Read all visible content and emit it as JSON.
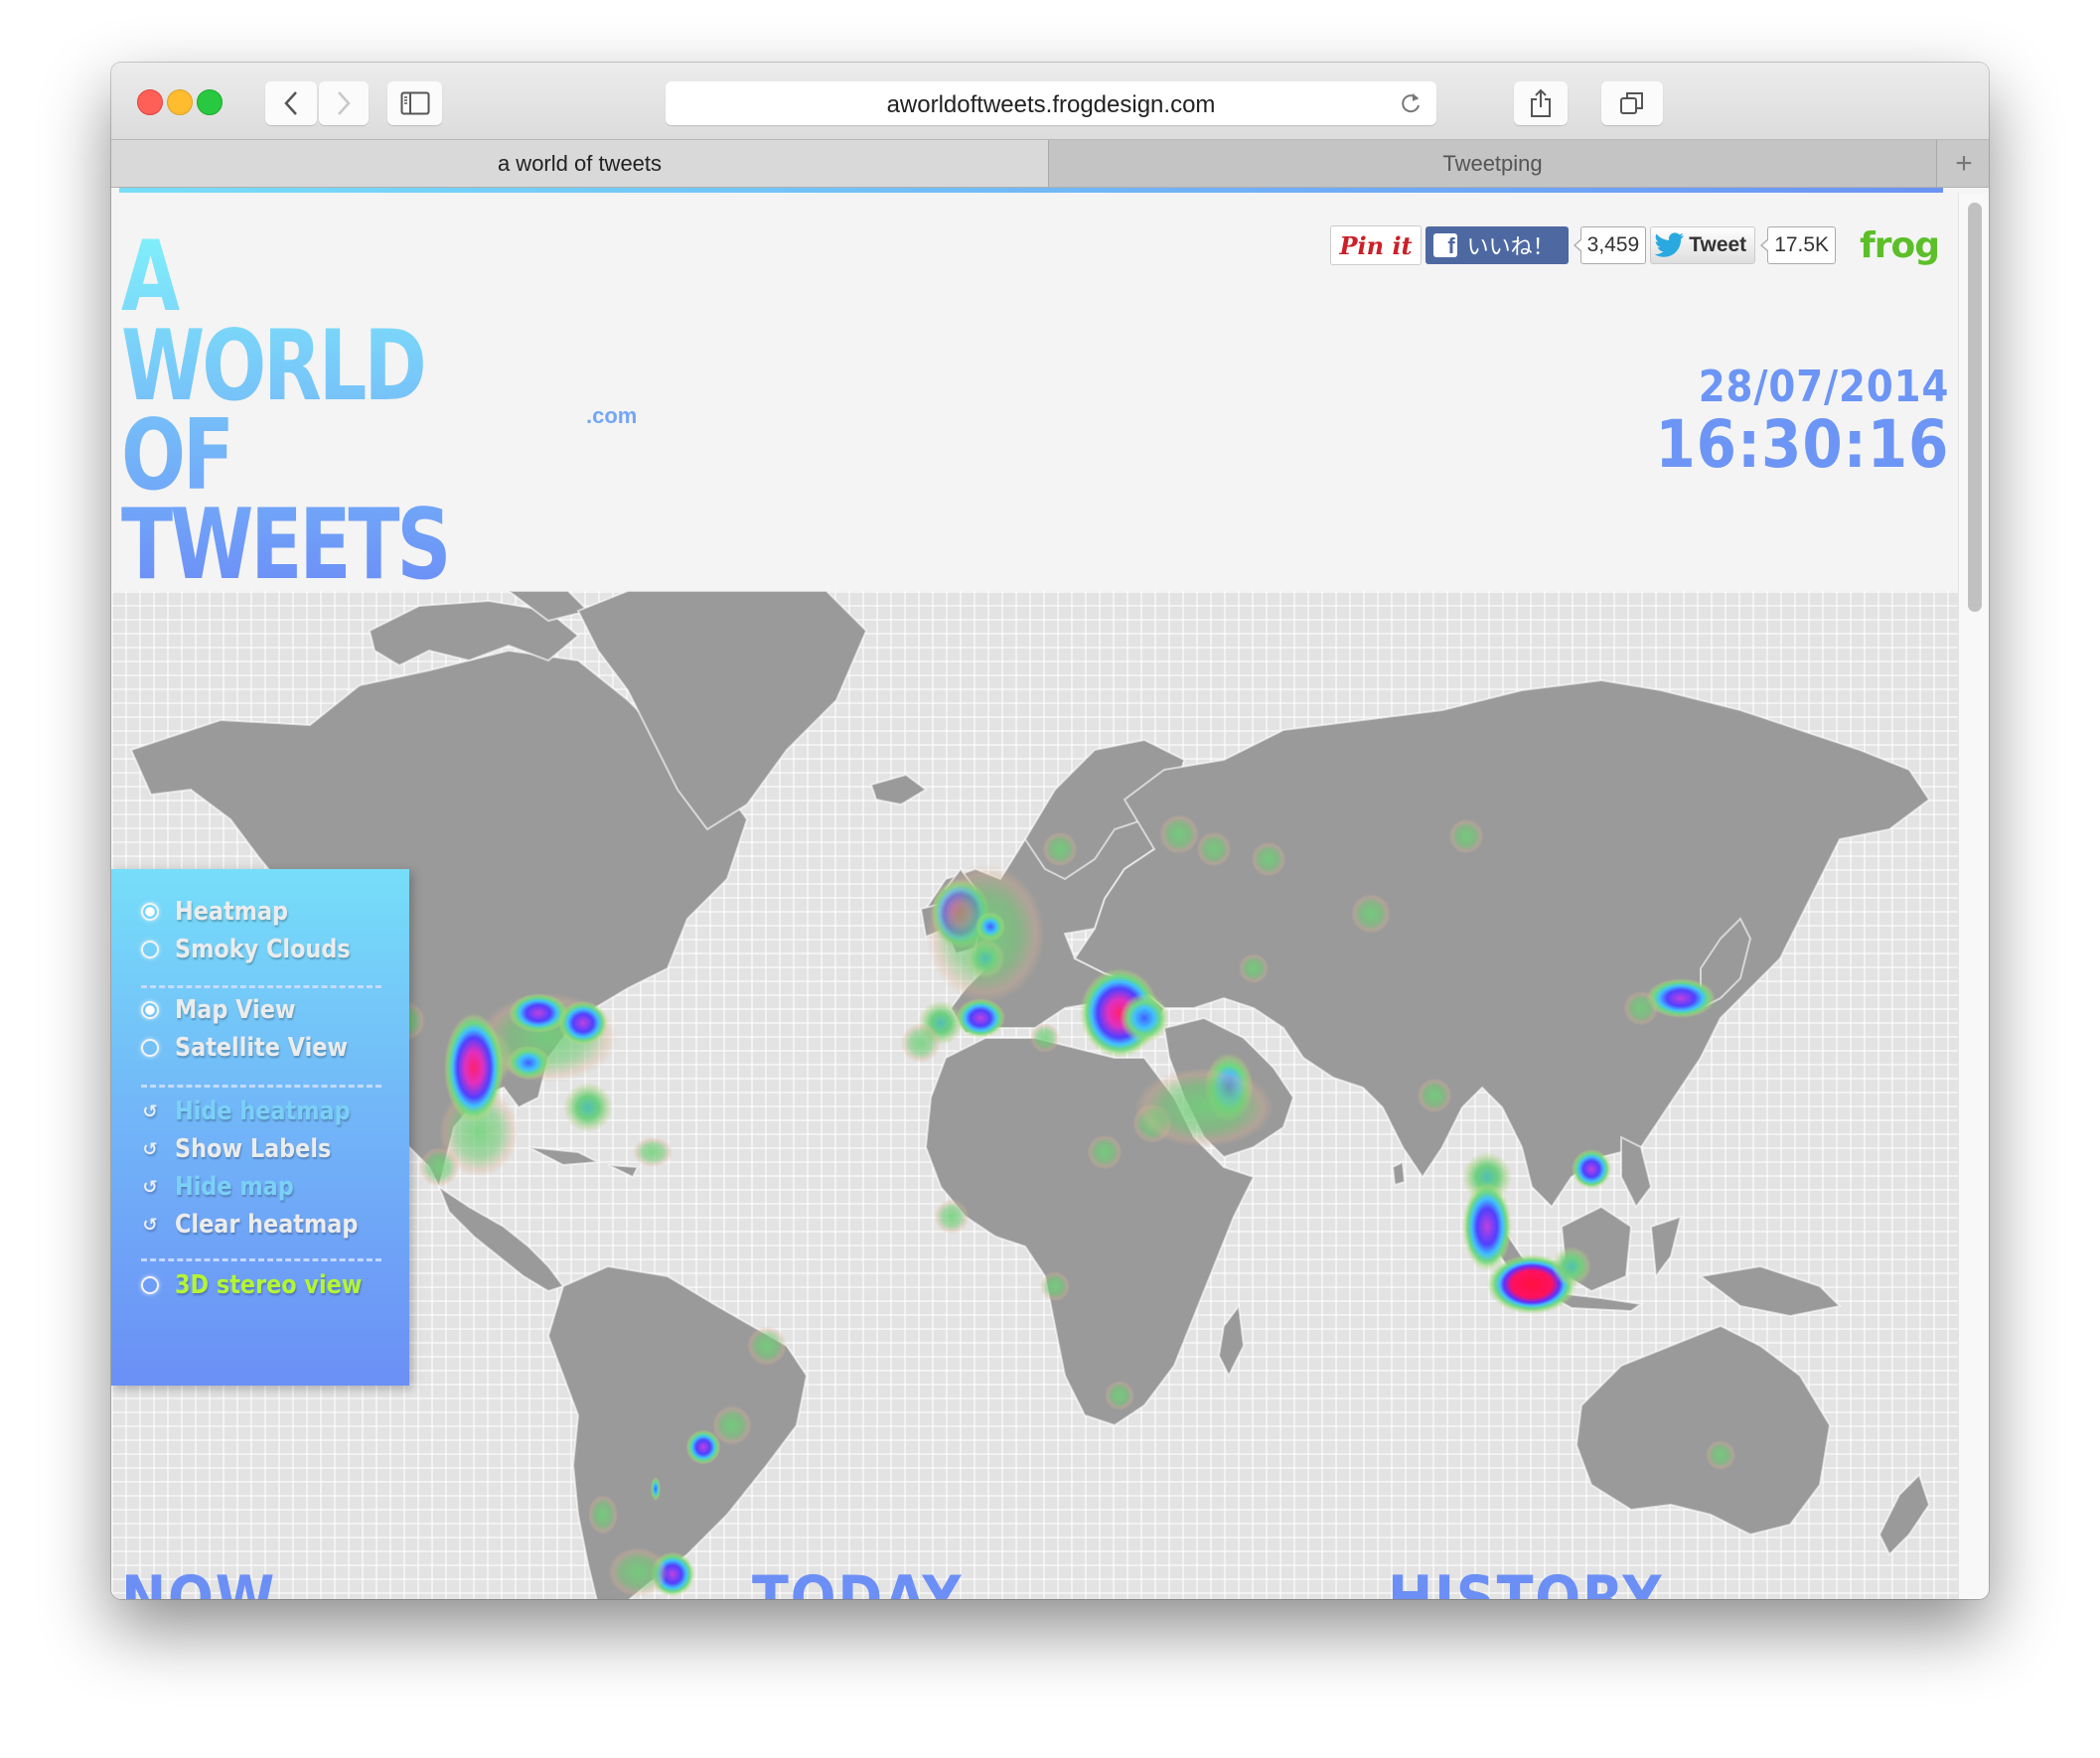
{
  "browser": {
    "url": "aworldoftweets.frogdesign.com",
    "tabs": [
      {
        "label": "a world of tweets",
        "active": true
      },
      {
        "label": "Tweetping",
        "active": false
      }
    ],
    "icons": {
      "back": "chevron-left-icon",
      "forward": "chevron-right-icon",
      "sidebar": "sidebar-icon",
      "reload": "reload-icon",
      "share": "share-icon",
      "tabs": "tab-overview-icon",
      "new_tab": "plus-icon"
    }
  },
  "page": {
    "logo": {
      "line1": "A",
      "line2": "WORLD",
      "line3": "OF TWEETS",
      "suffix": ".com"
    },
    "date": "28/07/2014",
    "time": "16:30:16",
    "social": {
      "pinit": "Pin it",
      "fb_like": "いいね！",
      "fb_count": "3,459",
      "tweet": "Tweet",
      "tweet_count": "17.5K",
      "brand": "frog"
    },
    "controls": {
      "render_modes": [
        {
          "label": "Heatmap",
          "selected": true
        },
        {
          "label": "Smoky Clouds",
          "selected": false
        }
      ],
      "view_modes": [
        {
          "label": "Map View",
          "selected": true
        },
        {
          "label": "Satellite View",
          "selected": false
        }
      ],
      "actions": [
        {
          "label": "Hide heatmap",
          "enabled": false
        },
        {
          "label": "Show Labels",
          "enabled": true
        },
        {
          "label": "Hide map",
          "enabled": false
        },
        {
          "label": "Clear heatmap",
          "enabled": true
        }
      ],
      "stereo": {
        "label": "3D stereo view",
        "selected": false
      }
    },
    "sections": [
      "NOW",
      "TODAY",
      "HISTORY"
    ],
    "colors": {
      "accent_blue": "#6c8ff6",
      "accent_cyan": "#76def9",
      "lime": "#b4f534",
      "frog_green": "#5cbf2a",
      "land": "#9a9a9a",
      "sea": "#e3e3e3"
    },
    "heat_hotspots": [
      {
        "region": "UK / London",
        "intensity": "high"
      },
      {
        "region": "Benelux",
        "intensity": "medium"
      },
      {
        "region": "Spain",
        "intensity": "medium"
      },
      {
        "region": "Turkey / Istanbul",
        "intensity": "high"
      },
      {
        "region": "Kuwait / Gulf",
        "intensity": "medium"
      },
      {
        "region": "US Great Lakes",
        "intensity": "medium-high"
      },
      {
        "region": "US Northeast",
        "intensity": "medium-high"
      },
      {
        "region": "Texas",
        "intensity": "high"
      },
      {
        "region": "US Southeast",
        "intensity": "medium"
      },
      {
        "region": "US West Coast",
        "intensity": "medium"
      },
      {
        "region": "Japan / Tokyo",
        "intensity": "medium-high"
      },
      {
        "region": "Philippines",
        "intensity": "medium"
      },
      {
        "region": "Thailand",
        "intensity": "low"
      },
      {
        "region": "Malaysia",
        "intensity": "medium-high"
      },
      {
        "region": "Indonesia / Jakarta",
        "intensity": "very high"
      },
      {
        "region": "Brazil / São Paulo",
        "intensity": "medium"
      },
      {
        "region": "Argentina / Buenos Aires",
        "intensity": "medium"
      }
    ]
  }
}
